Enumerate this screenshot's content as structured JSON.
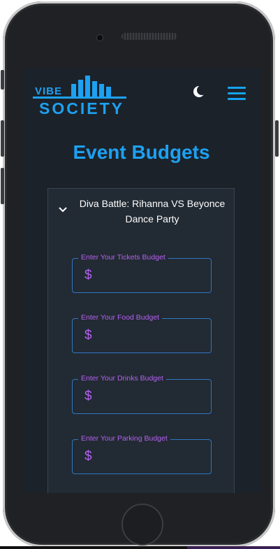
{
  "header": {
    "logo_top": "VIBE",
    "logo_bottom": "SOCIETY",
    "colors": {
      "accent": "#1da1f2",
      "label": "#b461f0",
      "background": "#1b222a",
      "panel": "#222a33"
    },
    "theme_toggle_icon": "moon-icon",
    "menu_icon": "hamburger-menu-icon"
  },
  "page": {
    "title": "Event Budgets"
  },
  "event": {
    "name": "Diva Battle: Rihanna VS Beyonce Dance Party",
    "expand_icon": "chevron-down-icon"
  },
  "fields": [
    {
      "label": "Enter Your Tickets Budget",
      "prefix": "$",
      "value": ""
    },
    {
      "label": "Enter Your Food Budget",
      "prefix": "$",
      "value": ""
    },
    {
      "label": "Enter Your Drinks Budget",
      "prefix": "$",
      "value": ""
    },
    {
      "label": "Enter Your Parking Budget",
      "prefix": "$",
      "value": ""
    }
  ]
}
